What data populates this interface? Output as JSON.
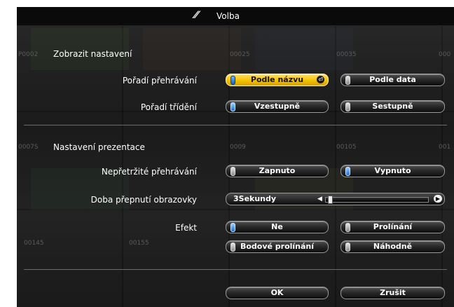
{
  "window": {
    "title": "Volba",
    "icon": "wand-icon"
  },
  "background_numbers": [
    "P0002",
    "00025",
    "00035",
    "000",
    "0007S",
    "0009",
    "00105",
    "001",
    "00145",
    "00155"
  ],
  "sections": {
    "display": "Zobrazit nastavení",
    "presentation": "Nastavení prezentace"
  },
  "rows": {
    "playback_order": {
      "label": "Pořadí přehrávání",
      "options": [
        "Podle názvu",
        "Podle data"
      ],
      "selected": "Podle názvu"
    },
    "sort_order": {
      "label": "Pořadí třídění",
      "options": [
        "Vzestupně",
        "Sestupně"
      ],
      "selected": "Vzestupně"
    },
    "continuous": {
      "label": "Nepřetržité přehrávání",
      "options": [
        "Zapnuto",
        "Vypnuto"
      ],
      "selected": "Vypnuto"
    },
    "switch_time": {
      "label": "Doba přepnutí obrazovky",
      "value": "3Sekundy",
      "level": 0.02
    },
    "effect": {
      "label": "Efekt",
      "options": [
        "Ne",
        "Prolínání",
        "Bodové prolínání",
        "Náhodně"
      ],
      "selected": "Ne"
    }
  },
  "actions": {
    "ok": "OK",
    "cancel": "Zrušit"
  },
  "colors": {
    "selected": "#f5c200",
    "radio_on": "#1a6fd6",
    "panel": "#0c0c0c"
  }
}
